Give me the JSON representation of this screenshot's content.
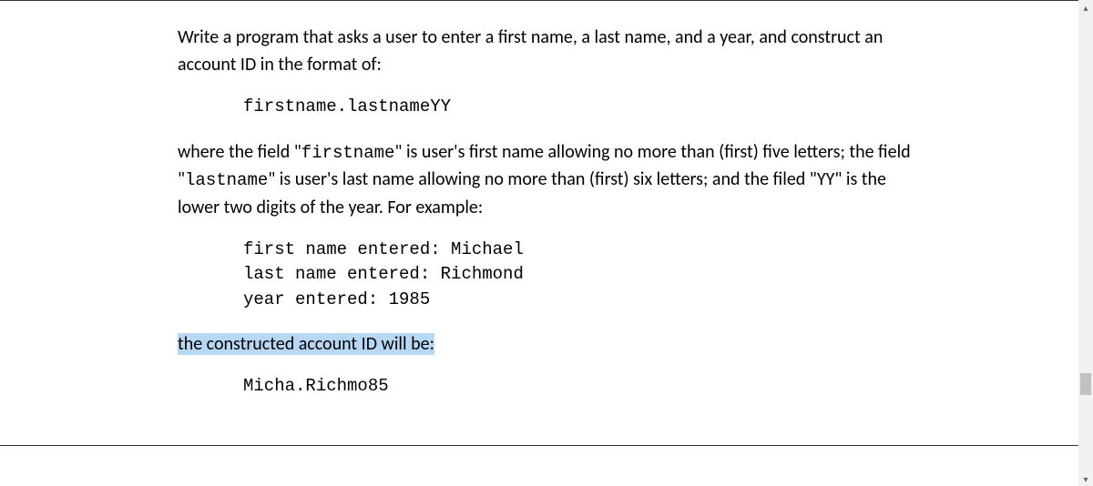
{
  "paragraph1": {
    "text": "Write a program that asks a user to enter a first name, a last name, and a year, and construct an account ID in the format of:"
  },
  "codeblock1": {
    "line1": "firstname.lastnameYY"
  },
  "paragraph2": {
    "prefix1": "where the field \"",
    "code1": "firstname",
    "mid1": "\" is user's first name allowing no more than (first) five letters; the field \"",
    "code2": "lastname",
    "mid2": "\" is user's last name allowing no more than (first) six letters; and the filed \"YY\" is the lower two digits of the year. For example:"
  },
  "codeblock2": {
    "line1": "first name entered: Michael",
    "line2": "last name entered: Richmond",
    "line3": "year entered: 1985"
  },
  "paragraph3": {
    "highlight": "the constructed account ID will be:"
  },
  "codeblock3": {
    "line1": "Micha.Richmo85"
  },
  "scroll": {
    "up": "▴",
    "down": "▾"
  }
}
